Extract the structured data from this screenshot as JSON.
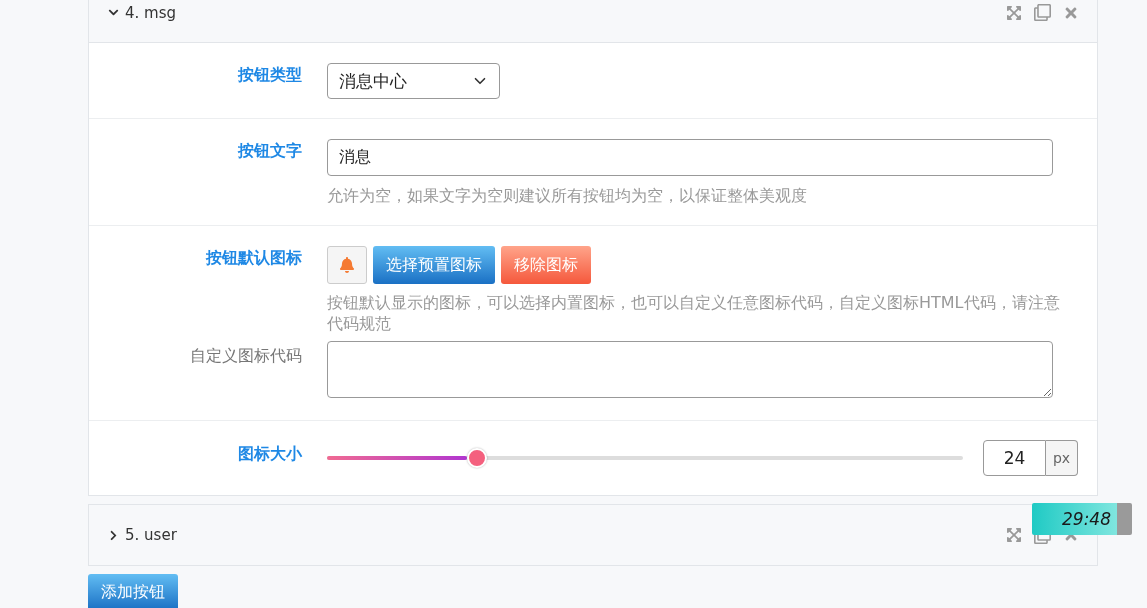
{
  "panels": [
    {
      "title": "4. msg",
      "expanded": true,
      "fields": [
        {
          "kind": "select",
          "label": "按钮类型",
          "value": "消息中心"
        },
        {
          "kind": "text",
          "label": "按钮文字",
          "value": "消息",
          "help": "允许为空，如果文字为空则建议所有按钮均为空，以保证整体美观度"
        },
        {
          "kind": "icon",
          "label": "按钮默认图标",
          "buttons": [
            {
              "kind": "primary",
              "label": "选择预置图标"
            },
            {
              "kind": "danger",
              "label": "移除图标"
            }
          ],
          "help": "按钮默认显示的图标，可以选择内置图标，也可以自定义任意图标代码，自定义图标HTML代码，请注意代码规范",
          "custom_label": "自定义图标代码"
        },
        {
          "kind": "slider",
          "label": "图标大小",
          "level": 0.236,
          "value": "24",
          "unit": "px"
        }
      ]
    },
    {
      "title": "5. user",
      "expanded": false
    }
  ],
  "add_button": "添加按钮",
  "timer": "29:48"
}
